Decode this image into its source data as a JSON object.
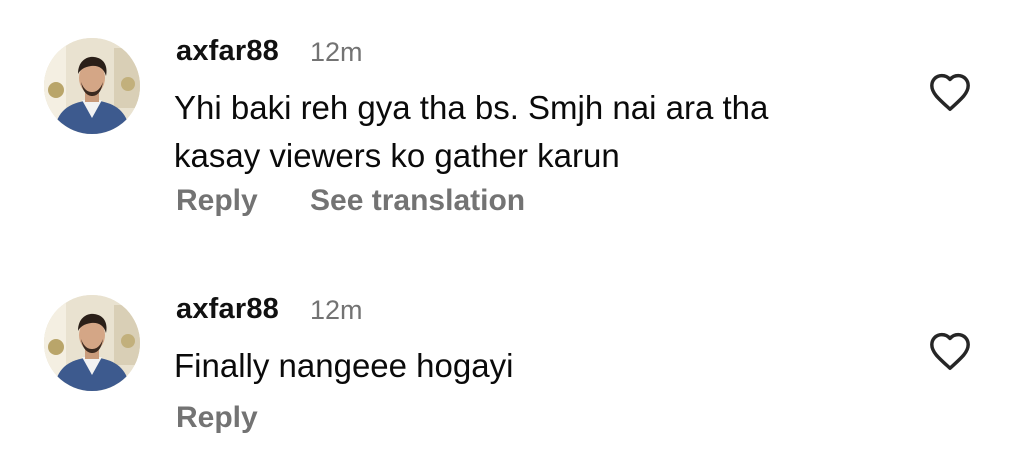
{
  "comments": [
    {
      "username": "axfar88",
      "time": "12m",
      "text_lines": [
        "Yhi baki reh gya tha bs. Smjh nai ara tha",
        "kasay viewers ko gather karun"
      ],
      "reply_label": "Reply",
      "translate_label": "See translation",
      "like_icon": "heart-outline-icon"
    },
    {
      "username": "axfar88",
      "time": "12m",
      "text_lines": [
        "Finally nangeee hogayi"
      ],
      "reply_label": "Reply",
      "like_icon": "heart-outline-icon"
    }
  ],
  "colors": {
    "text": "#0a0a0a",
    "secondary": "#737373",
    "background": "#ffffff"
  }
}
